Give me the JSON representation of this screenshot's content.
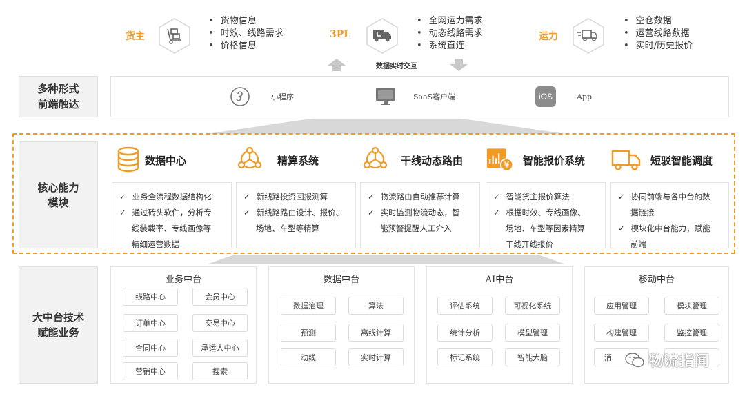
{
  "top": {
    "shipper": {
      "label": "货主",
      "icon": "hand-truck-icon",
      "bullets": [
        "货物信息",
        "时效、线路需求",
        "价格信息"
      ]
    },
    "tpl": {
      "label": "3PL",
      "icon": "delivery-truck-icon",
      "bullets": [
        "全网运力需求",
        "动态线路需求",
        "系统直连"
      ]
    },
    "carrier": {
      "label": "运力",
      "icon": "fast-truck-icon",
      "bullets": [
        "空仓数据",
        "运营线路数据",
        "实时/历史报价"
      ]
    },
    "interaction": "数据实时交互"
  },
  "rows": {
    "frontend": [
      "多种形式",
      "前端触达"
    ],
    "core": [
      "核心能力",
      "模块"
    ],
    "platform": [
      "大中台技术",
      "赋能业务"
    ]
  },
  "frontend_items": [
    {
      "icon": "mini-program-icon",
      "label": "小程序"
    },
    {
      "icon": "desktop-monitor-icon",
      "label": "SaaS客户端"
    },
    {
      "icon": "ios-icon",
      "icon_text": "iOS",
      "label": "App"
    }
  ],
  "modules": [
    {
      "title": "数据中心",
      "icon": "database-icon",
      "items": [
        [
          "业务全流程数据结构化"
        ],
        [
          "通过砖头软件，分析专",
          "线装载率、专线画像等",
          "精细运营数据"
        ]
      ]
    },
    {
      "title": "精算系统",
      "icon": "network-nodes-icon",
      "items": [
        [
          "新线路投资回报测算"
        ],
        [
          "新线路路由设计、报价、",
          "场地、车型等精算"
        ]
      ]
    },
    {
      "title": "干线动态路由",
      "icon": "route-nodes-icon",
      "items": [
        [
          "物流路由自动推荐计算"
        ],
        [
          "实时监测物流动态，智",
          "能预警提醒人工介入"
        ]
      ]
    },
    {
      "title": "智能报价系统",
      "icon": "price-chart-icon",
      "items": [
        [
          "智能货主报价算法"
        ],
        [
          "根据时效、专线画像、",
          "场地、车型等因素精算",
          "干线开线报价"
        ]
      ]
    },
    {
      "title": "短驳智能调度",
      "icon": "truck-outline-icon",
      "items": [
        [
          "协同前端与各中台的数",
          "据链接"
        ],
        [
          "模块化中台能力，赋能",
          "前端"
        ]
      ]
    }
  ],
  "platforms": [
    {
      "title": "业务中台",
      "chips": [
        "线路中心",
        "会员中心",
        "订单中心",
        "交易中心",
        "合同中心",
        "承运人中心",
        "营销中心",
        "搜索"
      ]
    },
    {
      "title": "数据中台",
      "chips": [
        "数据治理",
        "算法",
        "预测",
        "离线计算",
        "动线",
        "实时计算"
      ]
    },
    {
      "title": "AI中台",
      "chips": [
        "评估系统",
        "可视化系统",
        "统计分析",
        "模型管理",
        "标记系统",
        "智能大脑"
      ]
    },
    {
      "title": "移动中台",
      "chips": [
        "应用管理",
        "模块管理",
        "构建管理",
        "监控管理",
        "消"
      ]
    }
  ],
  "watermark": "物流指闻",
  "colors": {
    "accent": "#F29B24",
    "label_bg": "#F2F2F2",
    "border": "#E3E3E3"
  }
}
